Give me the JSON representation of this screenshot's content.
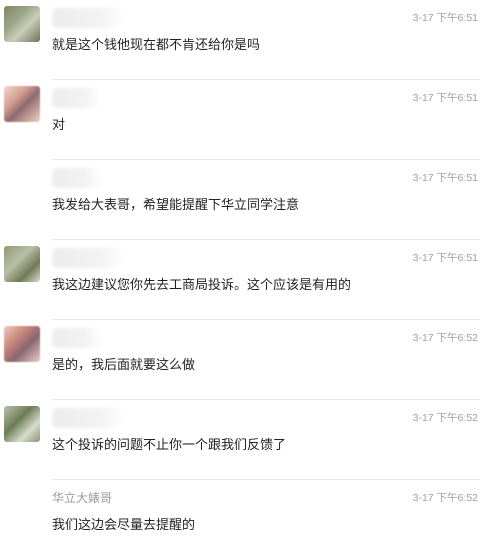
{
  "comments": [
    {
      "author": "",
      "time": "3-17 下午6:51",
      "text": "就是这个钱他现在都不肯还给你是吗"
    },
    {
      "author": "",
      "time": "3-17 下午6:51",
      "text": "对"
    },
    {
      "author": "",
      "time": "3-17 下午6:51",
      "text": "我发给大表哥，希望能提醒下华立同学注意"
    },
    {
      "author": "",
      "time": "3-17 下午6:51",
      "text": "我这边建议您你先去工商局投诉。这个应该是有用的"
    },
    {
      "author": "",
      "time": "3-17 下午6:52",
      "text": "是的，我后面就要这么做"
    },
    {
      "author": "",
      "time": "3-17 下午6:52",
      "text": "这个投诉的问题不止你一个跟我们反馈了"
    },
    {
      "author": "华立大婊哥",
      "time": "3-17 下午6:52",
      "text": "我们这边会尽量去提醒的"
    }
  ]
}
